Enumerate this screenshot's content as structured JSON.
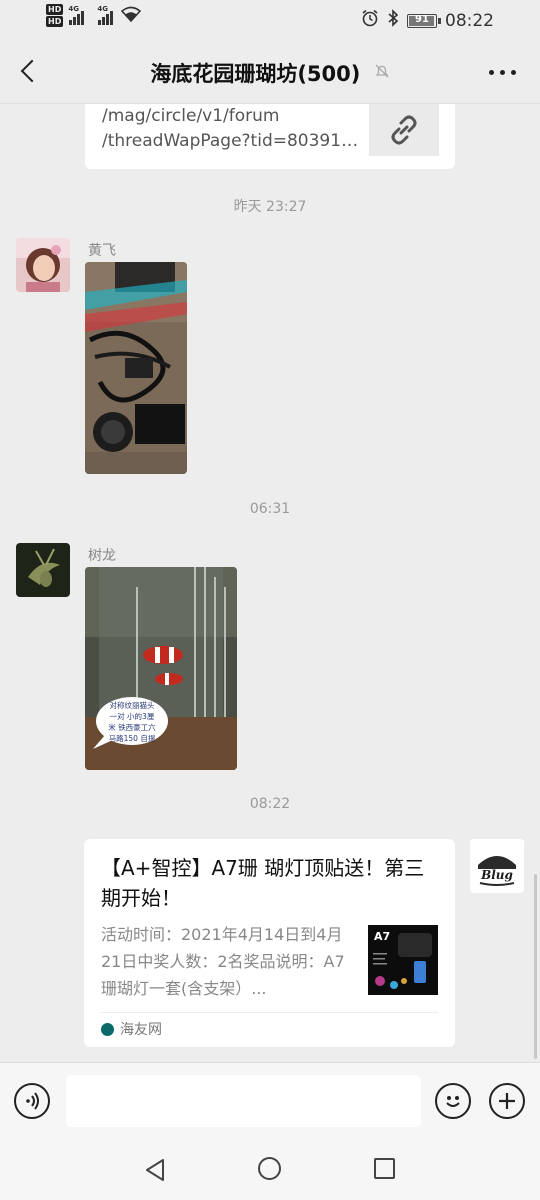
{
  "status_bar": {
    "hd1": "HD",
    "hd2": "HD",
    "net1": "4G",
    "net2": "4G",
    "battery": "91",
    "time": "08:22"
  },
  "header": {
    "title": "海底花园珊瑚坊(500)"
  },
  "link_message": {
    "url_text": "/mag/circle/v1/forum\n/threadWapPage?tid=80391…"
  },
  "messages": [
    {
      "timestamp": "昨天 23:27",
      "sender": "黄飞",
      "type": "image"
    },
    {
      "timestamp": "06:31",
      "sender": "树龙",
      "type": "image",
      "caption_lines": [
        "对称纹丽猫头",
        "一对  小的3厘",
        "米  铁西豪工六",
        "马路150  自提"
      ]
    },
    {
      "timestamp": "08:22",
      "type": "news_card"
    }
  ],
  "news_card": {
    "title": "【A+智控】A7珊 瑚灯顶贴送！第三期开始！",
    "description": "活动时间：2021年4月14日到4月21日中奖人数：2名奖品说明：A7珊瑚灯一套(含支架）...",
    "thumb_label": "A7",
    "source": "海友网"
  },
  "my_avatar_text": "Blug",
  "input": {
    "placeholder": ""
  }
}
